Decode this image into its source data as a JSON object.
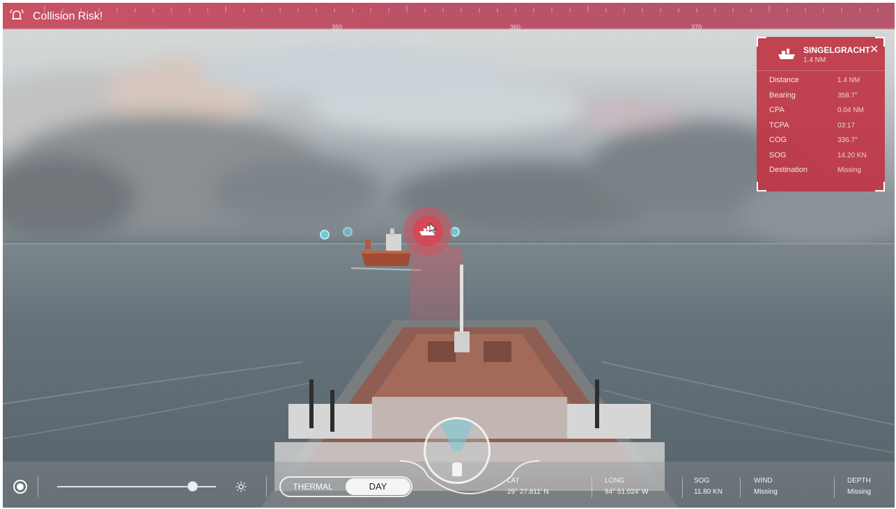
{
  "alert": {
    "title": "Collision Risk!",
    "icon": "alarm-bell-icon"
  },
  "heading_scale": {
    "labels": [
      "350",
      "360",
      "370"
    ]
  },
  "target_panel": {
    "vessel_name": "SINGELGRACHT",
    "range": "1.4 NM",
    "icon": "ship-icon",
    "rows": [
      {
        "label": "Distance",
        "value": "1.4 NM"
      },
      {
        "label": "Bearing",
        "value": "358.7°"
      },
      {
        "label": "CPA",
        "value": "0.04 NM"
      },
      {
        "label": "TCPA",
        "value": "03:17"
      },
      {
        "label": "COG",
        "value": "336.7°"
      },
      {
        "label": "SOG",
        "value": "14.20 KN"
      },
      {
        "label": "Destination",
        "value": "Missing"
      }
    ]
  },
  "bottom_bar": {
    "brightness_level": 0.85,
    "mode": {
      "thermal": "THERMAL",
      "day": "DAY",
      "selected": "DAY"
    },
    "stats": [
      {
        "label": "LAT",
        "value": "29° 27.811' N"
      },
      {
        "label": "LONG",
        "value": "94° 51.024' W"
      },
      {
        "label": "SOG",
        "value": "11.80 KN"
      },
      {
        "label": "WIND",
        "value": "Missing"
      },
      {
        "label": "DEPTH",
        "value": "Missing"
      }
    ]
  },
  "colors": {
    "alert": "#c84a5e",
    "panel": "#c03746",
    "marker": "#6fc6d6"
  }
}
